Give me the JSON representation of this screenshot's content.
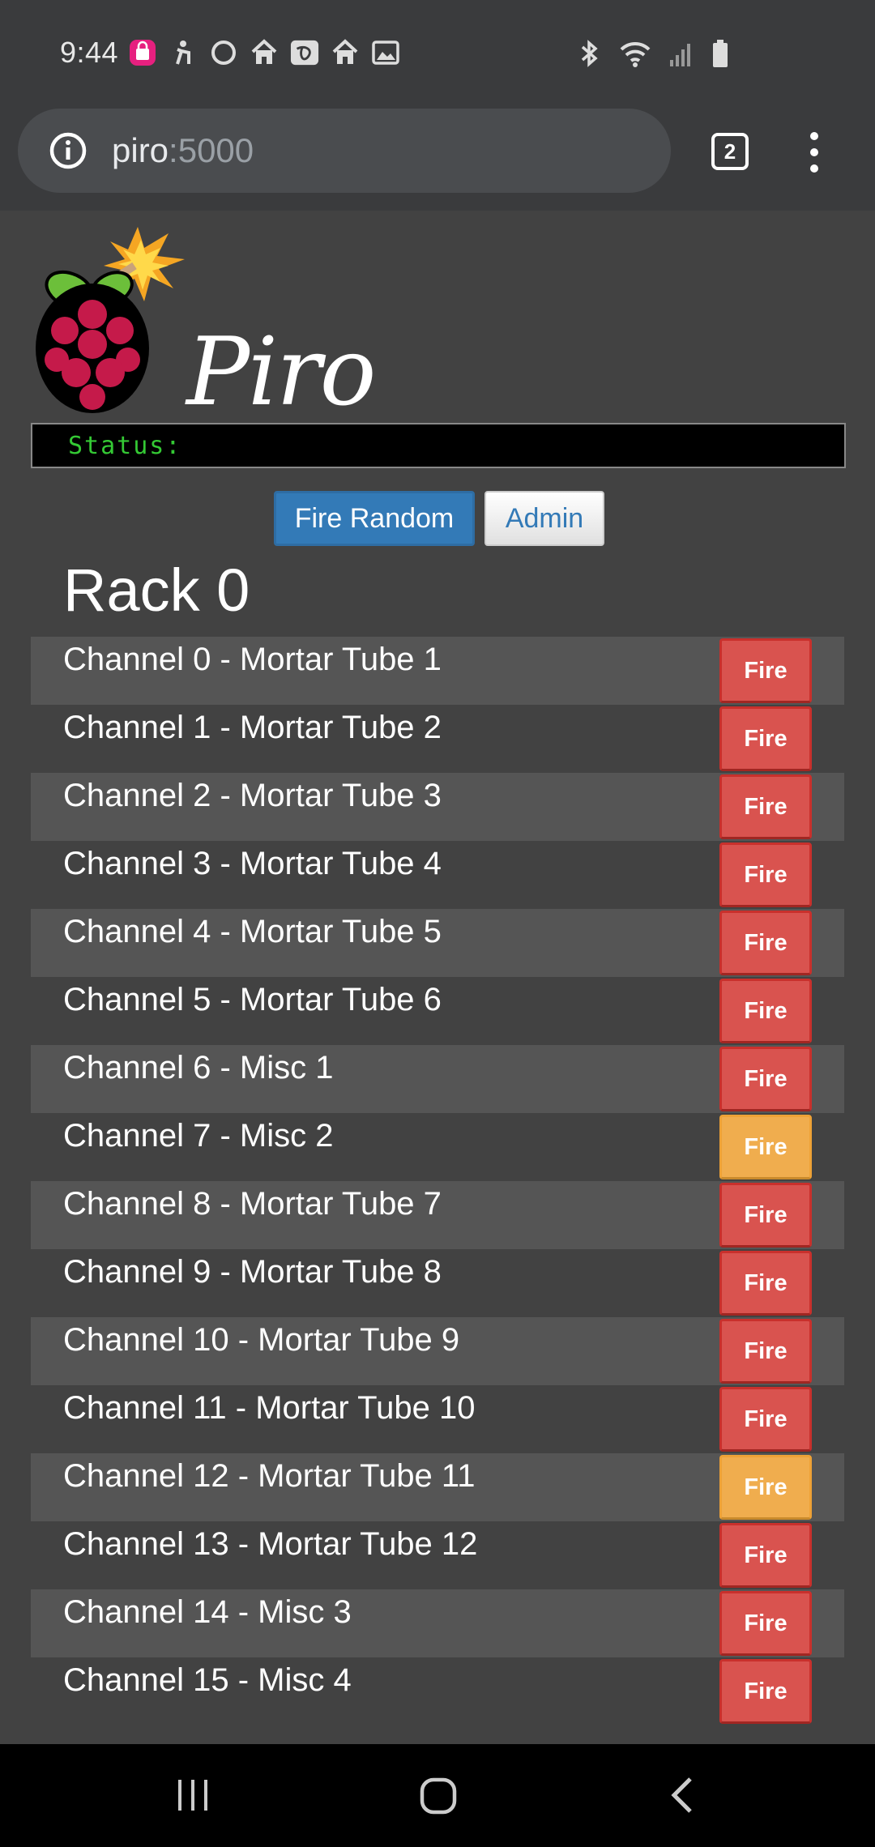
{
  "statusbar": {
    "time": "9:44",
    "icons": [
      "bag-app-icon",
      "accessibility-icon",
      "circle-icon",
      "home-icon",
      "disney-plus-icon",
      "home-icon",
      "image-icon"
    ],
    "right_icons": [
      "bluetooth-icon",
      "wifi-icon",
      "signal-icon",
      "battery-icon"
    ]
  },
  "browser": {
    "host": "piro",
    "port": ":5000",
    "tab_count": "2"
  },
  "header": {
    "logo_text": "Piro",
    "status_label": "Status:"
  },
  "buttons": {
    "fire_random": "Fire Random",
    "admin": "Admin"
  },
  "rack": {
    "title": "Rack 0",
    "fire_label": "Fire",
    "channels": [
      {
        "label": "Channel 0 - Mortar Tube 1",
        "state": "danger"
      },
      {
        "label": "Channel 1 - Mortar Tube 2",
        "state": "danger"
      },
      {
        "label": "Channel 2 - Mortar Tube 3",
        "state": "danger"
      },
      {
        "label": "Channel 3 - Mortar Tube 4",
        "state": "danger"
      },
      {
        "label": "Channel 4 - Mortar Tube 5",
        "state": "danger"
      },
      {
        "label": "Channel 5 - Mortar Tube 6",
        "state": "danger"
      },
      {
        "label": "Channel 6 - Misc 1",
        "state": "danger"
      },
      {
        "label": "Channel 7 - Misc 2",
        "state": "warning"
      },
      {
        "label": "Channel 8 - Mortar Tube 7",
        "state": "danger"
      },
      {
        "label": "Channel 9 - Mortar Tube 8",
        "state": "danger"
      },
      {
        "label": "Channel 10 - Mortar Tube 9",
        "state": "danger"
      },
      {
        "label": "Channel 11 - Mortar Tube 10",
        "state": "danger"
      },
      {
        "label": "Channel 12 - Mortar Tube 11",
        "state": "warning"
      },
      {
        "label": "Channel 13 - Mortar Tube 12",
        "state": "danger"
      },
      {
        "label": "Channel 14 - Misc 3",
        "state": "danger"
      },
      {
        "label": "Channel 15 - Misc 4",
        "state": "danger"
      }
    ]
  },
  "colors": {
    "danger": "#d9534f",
    "warning": "#f0ad4e",
    "primary": "#337ab7",
    "status_text": "#34c934"
  }
}
